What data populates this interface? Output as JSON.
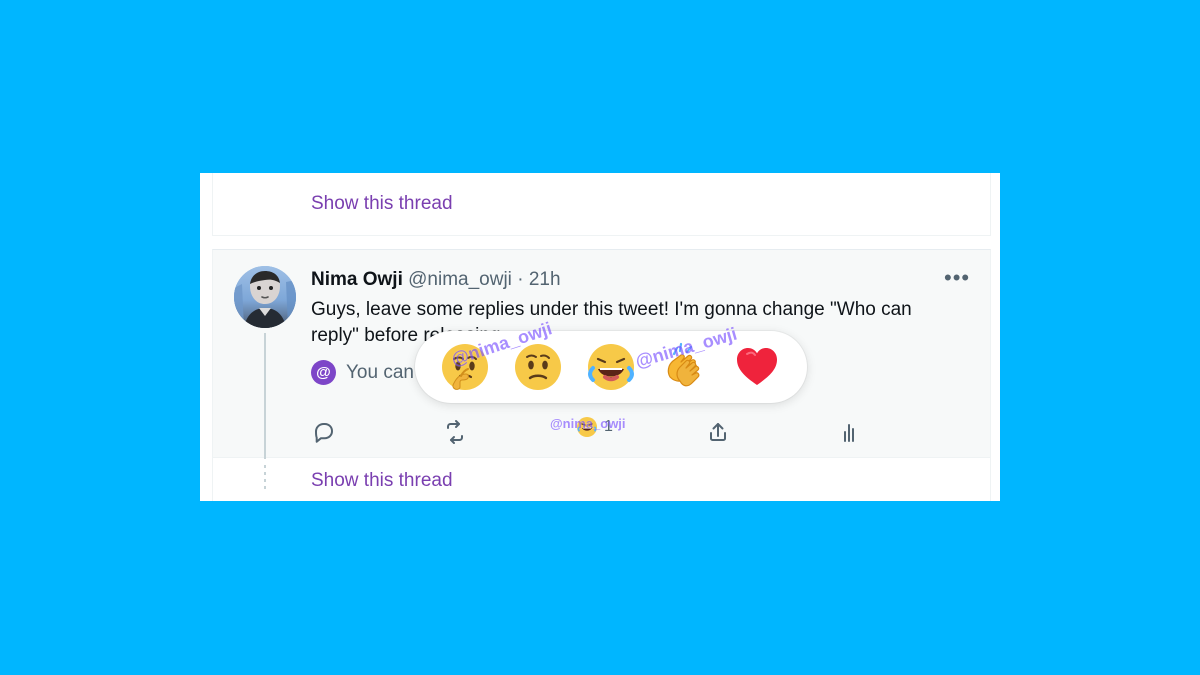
{
  "thread": {
    "show_thread_top": "Show this thread",
    "show_thread_bottom": "Show this thread"
  },
  "tweet": {
    "author_name": "Nima Owji",
    "author_handle": "@nima_owji",
    "separator": "·",
    "time": "21h",
    "text": "Guys, leave some replies under this tweet! I'm gonna change \"Who can reply\" before releasing",
    "reply_note_icon": "@",
    "reply_note": "You can reply to this conversation",
    "more_icon": "•••"
  },
  "actions": {
    "reaction_count": "1"
  },
  "popup": {
    "reactions": [
      "thinking-face",
      "confused-face",
      "laughing-face",
      "clapping-hands",
      "heart"
    ]
  },
  "watermarks": {
    "wm1": "@nima_owji",
    "wm2": "@nima_owji",
    "wm3": "@nima_owji"
  },
  "colors": {
    "page_background": "#00b6ff",
    "link_purple": "#7a3fb0",
    "reply_badge": "#7d46c8",
    "secondary_text": "#536471",
    "primary_text": "#0f1419",
    "heart": "#ef233c"
  }
}
